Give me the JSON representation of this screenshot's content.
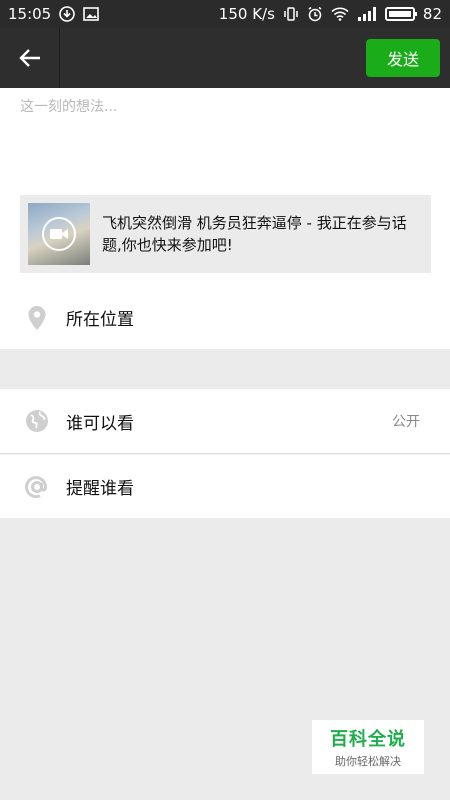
{
  "status_bar": {
    "time": "15:05",
    "speed": "150 K/s",
    "battery": "82",
    "icons": [
      "download-icon",
      "image-icon",
      "vibrate-icon",
      "alarm-icon",
      "wifi-icon",
      "signal-icon",
      "battery-icon"
    ]
  },
  "nav": {
    "back_icon": "back-arrow-icon",
    "send_label": "发送"
  },
  "compose": {
    "placeholder": "这一刻的想法...",
    "share": {
      "title": "飞机突然倒滑 机务员狂奔逼停 - 我正在参与话题,你也快来参加吧!",
      "thumbnail_icon": "video-camera-icon"
    }
  },
  "rows": {
    "location": {
      "label": "所在位置",
      "icon": "location-pin-icon"
    },
    "visibility": {
      "label": "谁可以看",
      "value": "公开",
      "icon": "globe-icon"
    },
    "remind": {
      "label": "提醒谁看",
      "icon": "at-sign-icon"
    }
  },
  "watermark": {
    "title": "百科全说",
    "subtitle": "助你轻松解决"
  },
  "colors": {
    "nav_bg": "#2e2e2e",
    "send_green": "#1aad19",
    "page_bg": "#ebebeb",
    "watermark_green": "#1fae4c"
  }
}
